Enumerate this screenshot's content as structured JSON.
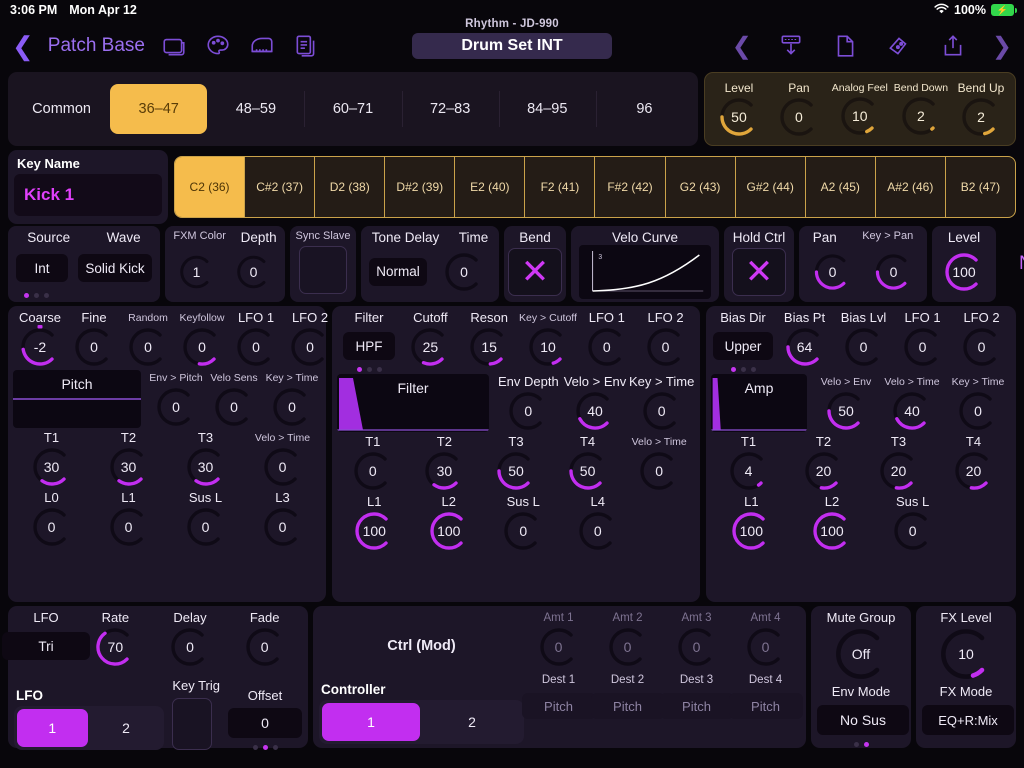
{
  "status_bar": {
    "time": "3:06 PM",
    "date": "Mon Apr 12",
    "battery_percent": "100%",
    "wifi_icon": "wifi-icon",
    "battery_icon": "battery-charging-icon"
  },
  "nav": {
    "back_label": "Patch Base",
    "subtitle": "Rhythm - JD-990",
    "title": "Drum Set INT",
    "icons": [
      "folder-icon",
      "palette-icon",
      "piano-icon",
      "copy-document-icon"
    ],
    "right_icons": [
      "chevron-left-icon",
      "download-icon",
      "document-icon",
      "edit-patch-icon",
      "upload-icon",
      "chevron-right-icon"
    ]
  },
  "banks": {
    "items": [
      "Common",
      "36–47",
      "48–59",
      "60–71",
      "72–83",
      "84–95",
      "96"
    ],
    "active_index": 1
  },
  "globals": [
    {
      "label": "Level",
      "value": "50",
      "pct": 0.5,
      "small": false
    },
    {
      "label": "Pan",
      "value": "0",
      "pct": 0.0,
      "small": false
    },
    {
      "label": "Analog Feel",
      "value": "10",
      "pct": 0.08,
      "small": true
    },
    {
      "label": "Bend Down",
      "value": "2",
      "pct": 0.02,
      "small": true
    },
    {
      "label": "Bend Up",
      "value": "2",
      "pct": 0.12,
      "small": false
    }
  ],
  "key_name": {
    "label": "Key Name",
    "value": "Kick 1"
  },
  "notes": {
    "items": [
      "C2 (36)",
      "C#2 (37)",
      "D2 (38)",
      "D#2 (39)",
      "E2 (40)",
      "F2 (41)",
      "F#2 (42)",
      "G2 (43)",
      "G#2 (44)",
      "A2 (45)",
      "A#2 (46)",
      "B2 (47)"
    ],
    "active_index": 0
  },
  "source_row": {
    "source": {
      "label": "Source",
      "value": "Int"
    },
    "wave": {
      "label": "Wave",
      "value": "Solid Kick"
    },
    "fxm_color": {
      "label": "FXM Color",
      "value": "1",
      "pct": 0.0
    },
    "depth": {
      "label": "Depth",
      "value": "0",
      "pct": 0.0
    },
    "sync_slave": {
      "label": "Sync Slave"
    },
    "tone_delay": {
      "label": "Tone Delay",
      "value": "Normal"
    },
    "time": {
      "label": "Time",
      "value": "0",
      "pct": 0.0
    },
    "bend": {
      "label": "Bend",
      "icon": "x-mark-icon"
    },
    "velo_curve": {
      "label": "Velo Curve",
      "curve_number": "3"
    },
    "hold_ctrl": {
      "label": "Hold Ctrl",
      "icon": "x-mark-icon"
    },
    "pan": {
      "label": "Pan",
      "value": "0",
      "pct": 0.5
    },
    "key_pan": {
      "label": "Key > Pan",
      "value": "0",
      "pct": 0.5
    },
    "level": {
      "label": "Level",
      "value": "100",
      "pct": 1.0
    },
    "note_tag": "Note"
  },
  "pitch": {
    "top": [
      {
        "label": "Coarse",
        "value": "-2",
        "pct": 0.47,
        "tick": true
      },
      {
        "label": "Fine",
        "value": "0",
        "pct": 0.0
      },
      {
        "label": "Random",
        "value": "0",
        "pct": 0.0,
        "small": true
      },
      {
        "label": "Keyfollow",
        "value": "0",
        "pct": 0.2,
        "small": true
      },
      {
        "label": "LFO 1",
        "value": "0",
        "pct": 0.0
      },
      {
        "label": "LFO 2",
        "value": "0",
        "pct": 0.0
      }
    ],
    "env_title": "Pitch",
    "mid": [
      {
        "label": "Env > Pitch",
        "value": "0",
        "pct": 0.0,
        "small": true
      },
      {
        "label": "Velo Sens",
        "value": "0",
        "pct": 0.0,
        "small": true
      },
      {
        "label": "Key > Time",
        "value": "0",
        "pct": 0.0,
        "small": true
      }
    ],
    "times": [
      {
        "label": "T1",
        "value": "30",
        "pct": 0.3
      },
      {
        "label": "T2",
        "value": "30",
        "pct": 0.3
      },
      {
        "label": "T3",
        "value": "30",
        "pct": 0.3
      },
      {
        "label": "Velo > Time",
        "value": "0",
        "pct": 0.0,
        "small": true
      }
    ],
    "levels": [
      {
        "label": "L0",
        "value": "0",
        "pct": 0.0
      },
      {
        "label": "L1",
        "value": "0",
        "pct": 0.0
      },
      {
        "label": "Sus L",
        "value": "0",
        "pct": 0.0
      },
      {
        "label": "L3",
        "value": "0",
        "pct": 0.0
      }
    ]
  },
  "filter": {
    "type": {
      "label": "Filter",
      "value": "HPF"
    },
    "top": [
      {
        "label": "Cutoff",
        "value": "25",
        "pct": 0.25
      },
      {
        "label": "Reson",
        "value": "15",
        "pct": 0.15
      },
      {
        "label": "Key > Cutoff",
        "value": "10",
        "pct": 0.1,
        "small": true
      },
      {
        "label": "LFO 1",
        "value": "0",
        "pct": 0.0
      },
      {
        "label": "LFO 2",
        "value": "0",
        "pct": 0.0
      }
    ],
    "env_title": "Filter",
    "mid": [
      {
        "label": "Env Depth",
        "value": "0",
        "pct": 0.0
      },
      {
        "label": "Velo > Env",
        "value": "40",
        "pct": 0.4
      },
      {
        "label": "Key > Time",
        "value": "0",
        "pct": 0.0
      }
    ],
    "times": [
      {
        "label": "T1",
        "value": "0",
        "pct": 0.0
      },
      {
        "label": "T2",
        "value": "30",
        "pct": 0.3
      },
      {
        "label": "T3",
        "value": "50",
        "pct": 0.5
      },
      {
        "label": "T4",
        "value": "50",
        "pct": 0.5
      },
      {
        "label": "Velo > Time",
        "value": "0",
        "pct": 0.0,
        "small": true
      }
    ],
    "levels": [
      {
        "label": "L1",
        "value": "100",
        "pct": 1.0
      },
      {
        "label": "L2",
        "value": "100",
        "pct": 1.0
      },
      {
        "label": "Sus L",
        "value": "0",
        "pct": 0.0
      },
      {
        "label": "L4",
        "value": "0",
        "pct": 0.0
      }
    ]
  },
  "amp": {
    "bias_dir": {
      "label": "Bias Dir",
      "value": "Upper"
    },
    "top": [
      {
        "label": "Bias Pt",
        "value": "64",
        "pct": 0.5
      },
      {
        "label": "Bias Lvl",
        "value": "0",
        "pct": 0.0
      },
      {
        "label": "LFO 1",
        "value": "0",
        "pct": 0.0
      },
      {
        "label": "LFO 2",
        "value": "0",
        "pct": 0.0
      }
    ],
    "env_title": "Amp",
    "mid": [
      {
        "label": "Velo > Env",
        "value": "50",
        "pct": 0.5,
        "small": true
      },
      {
        "label": "Velo > Time",
        "value": "40",
        "pct": 0.4,
        "small": true
      },
      {
        "label": "Key > Time",
        "value": "0",
        "pct": 0.0,
        "small": true
      }
    ],
    "times": [
      {
        "label": "T1",
        "value": "4",
        "pct": 0.04
      },
      {
        "label": "T2",
        "value": "20",
        "pct": 0.2
      },
      {
        "label": "T3",
        "value": "20",
        "pct": 0.2
      },
      {
        "label": "T4",
        "value": "20",
        "pct": 0.2
      }
    ],
    "levels": [
      {
        "label": "L1",
        "value": "100",
        "pct": 1.0
      },
      {
        "label": "L2",
        "value": "100",
        "pct": 1.0
      },
      {
        "label": "Sus L",
        "value": "0",
        "pct": 0.0
      }
    ]
  },
  "lfo_panel": {
    "wave": {
      "label": "LFO",
      "value": "Tri"
    },
    "rate": {
      "label": "Rate",
      "value": "70",
      "pct": 0.7
    },
    "delay": {
      "label": "Delay",
      "value": "0",
      "pct": 0.0
    },
    "fade": {
      "label": "Fade",
      "value": "0",
      "pct": 0.0
    },
    "selector_label": "LFO",
    "selector_items": [
      "1",
      "2"
    ],
    "selector_active": 0,
    "key_trig": {
      "label": "Key Trig"
    },
    "offset": {
      "label": "Offset",
      "value": "0"
    }
  },
  "ctrl_panel": {
    "title": "Ctrl  (Mod)",
    "controller_label": "Controller",
    "selector_items": [
      "1",
      "2"
    ],
    "selector_active": 0,
    "amounts": [
      {
        "label": "Amt 1",
        "value": "0",
        "pct": 0.0
      },
      {
        "label": "Amt 2",
        "value": "0",
        "pct": 0.0
      },
      {
        "label": "Amt 3",
        "value": "0",
        "pct": 0.0
      },
      {
        "label": "Amt 4",
        "value": "0",
        "pct": 0.0
      }
    ],
    "destinations": [
      {
        "label": "Dest 1",
        "value": "Pitch"
      },
      {
        "label": "Dest 2",
        "value": "Pitch"
      },
      {
        "label": "Dest 3",
        "value": "Pitch"
      },
      {
        "label": "Dest 4",
        "value": "Pitch"
      }
    ]
  },
  "mute_panel": {
    "mute_group": {
      "label": "Mute Group",
      "value": "Off",
      "pct": 0.0
    },
    "env_mode": {
      "label": "Env Mode",
      "value": "No Sus"
    }
  },
  "fx_panel": {
    "fx_level": {
      "label": "FX Level",
      "value": "10",
      "pct": 0.1
    },
    "fx_mode": {
      "label": "FX Mode",
      "value": "EQ+R:Mix"
    }
  },
  "colors": {
    "accent_magenta": "#c22ef0",
    "accent_amber": "#f5bc4c",
    "panel": "#1d1628",
    "background": "#08060b"
  }
}
